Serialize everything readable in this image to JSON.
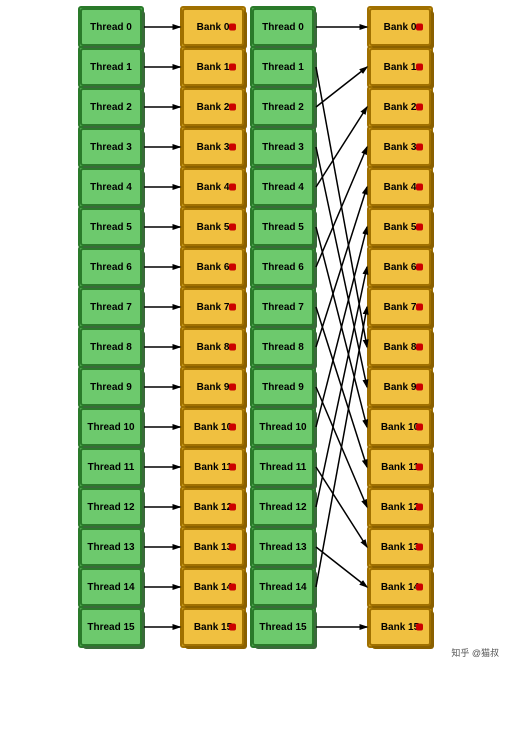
{
  "diagrams": [
    {
      "id": "left",
      "threads": [
        "Thread 0",
        "Thread 1",
        "Thread 2",
        "Thread 3",
        "Thread 4",
        "Thread 5",
        "Thread 6",
        "Thread 7",
        "Thread 8",
        "Thread 9",
        "Thread 10",
        "Thread 11",
        "Thread 12",
        "Thread 13",
        "Thread 14",
        "Thread 15"
      ],
      "banks": [
        "Bank 0",
        "Bank 1",
        "Bank 2",
        "Bank 3",
        "Bank 4",
        "Bank 5",
        "Bank 6",
        "Bank 7",
        "Bank 8",
        "Bank 9",
        "Bank 10",
        "Bank 11",
        "Bank 12",
        "Bank 13",
        "Bank 14",
        "Bank 15"
      ],
      "arrows": "straight"
    },
    {
      "id": "right",
      "threads": [
        "Thread 0",
        "Thread 1",
        "Thread 2",
        "Thread 3",
        "Thread 4",
        "Thread 5",
        "Thread 6",
        "Thread 7",
        "Thread 8",
        "Thread 9",
        "Thread 10",
        "Thread 11",
        "Thread 12",
        "Thread 13",
        "Thread 14",
        "Thread 15"
      ],
      "banks": [
        "Bank 0",
        "Bank 1",
        "Bank 2",
        "Bank 3",
        "Bank 4",
        "Bank 5",
        "Bank 6",
        "Bank 7",
        "Bank 8",
        "Bank 9",
        "Bank 10",
        "Bank 11",
        "Bank 12",
        "Bank 13",
        "Bank 14",
        "Bank 15"
      ],
      "arrows": "crossing"
    }
  ],
  "watermark": "知乎 @猫叔"
}
